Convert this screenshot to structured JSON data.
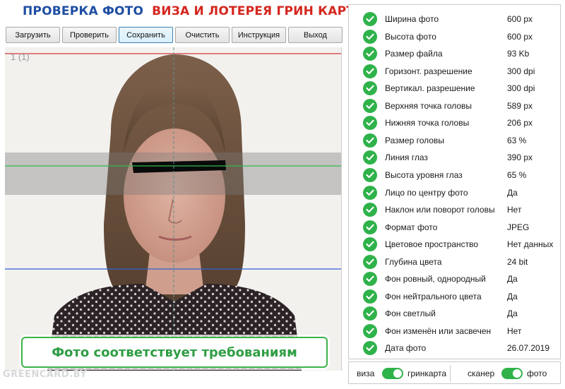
{
  "header": {
    "title_check": "ПРОВЕРКА ФОТО",
    "title_visa": "ВИЗА И ЛОТЕРЕЯ ГРИН КАРТА"
  },
  "toolbar": {
    "load": "Загрузить",
    "check": "Проверить",
    "save": "Сохранить",
    "clear": "Очистить",
    "instructions": "Инструкция",
    "exit": "Выход"
  },
  "photo": {
    "counter": "1 (1)",
    "watermark": "GREENCARD.BY",
    "result_text": "Фото соответствует требованиям"
  },
  "results": [
    {
      "label": "Ширина фото",
      "value": "600 px"
    },
    {
      "label": "Высота фото",
      "value": "600 px"
    },
    {
      "label": "Размер файла",
      "value": "93 Kb"
    },
    {
      "label": "Горизонт. разрешение",
      "value": "300 dpi"
    },
    {
      "label": "Вертикал. разрешение",
      "value": "300 dpi"
    },
    {
      "label": "Верхняя точка головы",
      "value": "589 px"
    },
    {
      "label": "Нижняя точка головы",
      "value": "206 px"
    },
    {
      "label": "Размер головы",
      "value": "63 %"
    },
    {
      "label": "Линия глаз",
      "value": "390 px"
    },
    {
      "label": "Высота уровня глаз",
      "value": "65 %"
    },
    {
      "label": "Лицо по центру фото",
      "value": "Да"
    },
    {
      "label": "Наклон или поворот головы",
      "value": "Нет"
    },
    {
      "label": "Формат фото",
      "value": "JPEG"
    },
    {
      "label": "Цветовое пространство",
      "value": "Нет данных"
    },
    {
      "label": "Глубина цвета",
      "value": "24 bit"
    },
    {
      "label": "Фон ровный, однородный",
      "value": "Да"
    },
    {
      "label": "Фон нейтрального цвета",
      "value": "Да"
    },
    {
      "label": "Фон светлый",
      "value": "Да"
    },
    {
      "label": "Фон изменён или засвечен",
      "value": "Нет"
    },
    {
      "label": "Дата фото",
      "value": "26.07.2019"
    }
  ],
  "toggles": {
    "left_off_label": "виза",
    "left_on_label": "гринкарта",
    "left_state": true,
    "right_off_label": "сканер",
    "right_on_label": "фото",
    "right_state": true
  },
  "colors": {
    "accent_green": "#2fb24a",
    "title_blue": "#1f4ea3",
    "title_red": "#d4261f",
    "guide_red": "#d23a3a",
    "guide_green": "#2dbb4c",
    "guide_blue": "#2e62d6"
  },
  "icons": {
    "status": "check-circle-icon"
  }
}
